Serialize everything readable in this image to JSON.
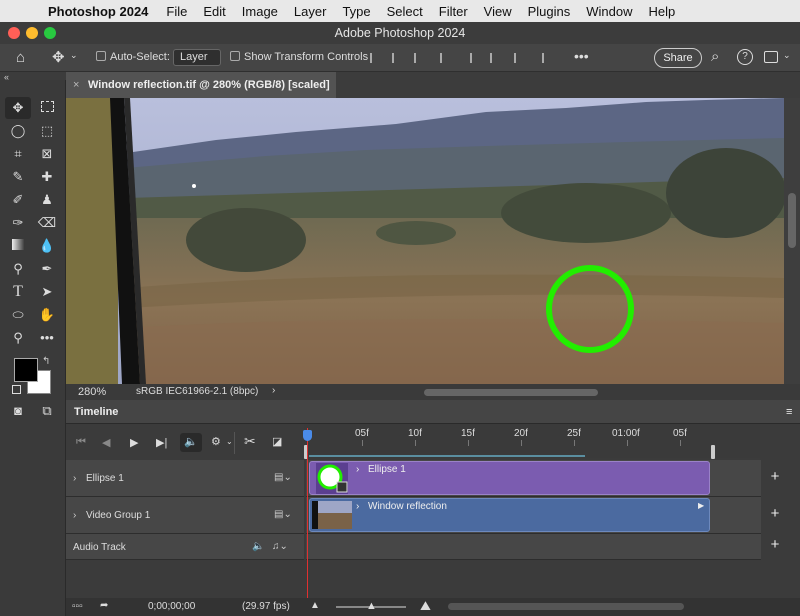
{
  "menubar": {
    "app": "Photoshop 2024",
    "items": [
      "File",
      "Edit",
      "Image",
      "Layer",
      "Type",
      "Select",
      "Filter",
      "View",
      "Plugins",
      "Window",
      "Help"
    ]
  },
  "window": {
    "title": "Adobe Photoshop 2024"
  },
  "options": {
    "auto_select_label": "Auto-Select:",
    "auto_select_value": "Layer",
    "transform_label": "Show Transform Controls",
    "share_label": "Share"
  },
  "document": {
    "tab_title": "Window reflection.tif @ 280% (RGB/8) [scaled] *",
    "zoom": "280%",
    "color_profile": "sRGB IEC61966-2.1 (8bpc)"
  },
  "timeline": {
    "title": "Timeline",
    "ruler_labels": [
      "05f",
      "10f",
      "15f",
      "20f",
      "25f",
      "01:00f",
      "05f"
    ],
    "tracks": [
      {
        "name": "Ellipse 1",
        "clip_label": "Ellipse 1"
      },
      {
        "name": "Video Group 1",
        "clip_label": "Window reflection"
      },
      {
        "name": "Audio Track"
      }
    ],
    "timecode": "0;00;00;00",
    "fps": "(29.97 fps)"
  },
  "colors": {
    "ellipse_clip": "#7b5cb0",
    "video_clip": "#4b6aa0",
    "green_ellipse": "#22ee00",
    "playhead": "#e03030"
  }
}
